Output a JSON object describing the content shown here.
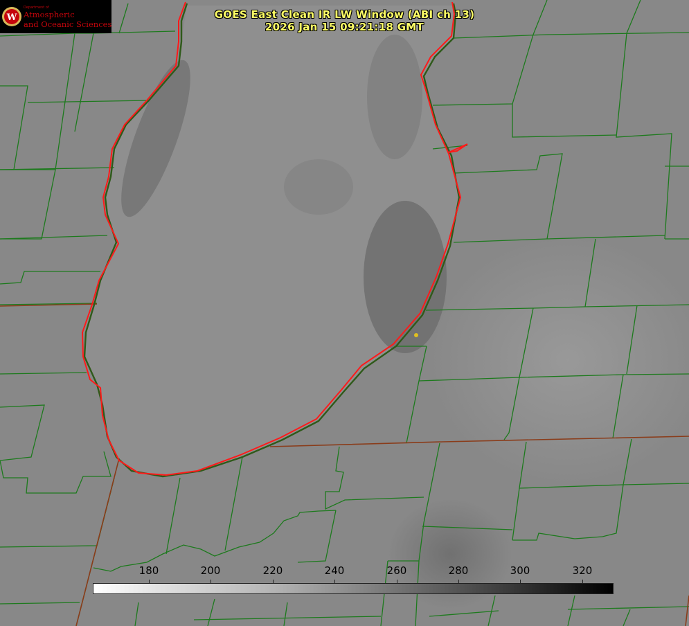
{
  "title": "GOES East Clean IR LW Window (ABI ch 13)",
  "subtitle": "2026 Jan 15 09:21:18 GMT",
  "logo": {
    "dept": "Department of",
    "line1": "Atmospheric",
    "line2": "and Oceanic Sciences"
  },
  "colorbar": {
    "ticks": [
      "180",
      "200",
      "220",
      "240",
      "260",
      "280",
      "300",
      "320"
    ]
  },
  "colors": {
    "title": "#ffff66",
    "county_lines": "#1d7a1d",
    "shoreline": "#ff1a1a",
    "state_line": "#8a3c1a",
    "marker": "#e0c020"
  }
}
